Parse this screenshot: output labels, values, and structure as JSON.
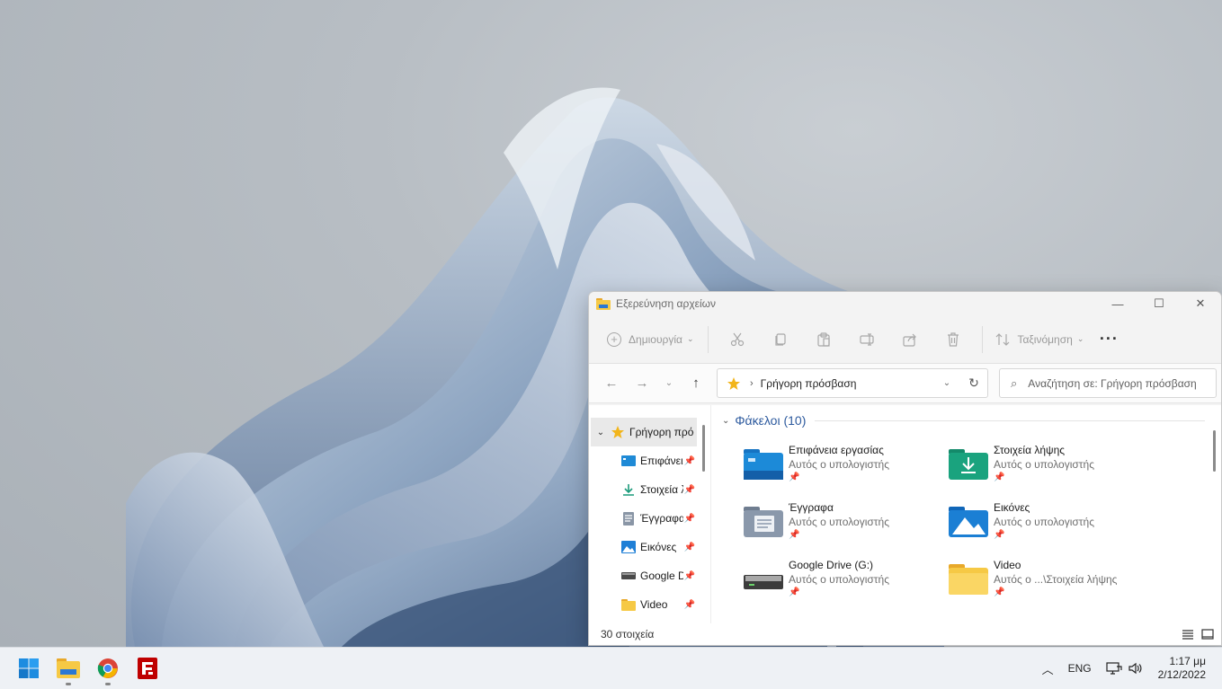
{
  "window": {
    "title": "Εξερεύνηση αρχείων",
    "controls": {
      "minimize": "—",
      "maximize": "☐",
      "close": "✕"
    }
  },
  "commandbar": {
    "new_label": "Δημιουργία",
    "sort_label": "Ταξινόμηση",
    "more_label": "···",
    "icons": [
      "cut-icon",
      "copy-icon",
      "paste-icon",
      "rename-icon",
      "share-icon",
      "delete-icon"
    ]
  },
  "address": {
    "crumb": "Γρήγορη πρόσβαση",
    "search_placeholder": "Αναζήτηση σε: Γρήγορη πρόσβαση"
  },
  "navpane": {
    "root_label": "Γρήγορη πρόσβαση",
    "items": [
      {
        "label": "Επιφάνεια εργασίας",
        "icon": "desktop-icon"
      },
      {
        "label": "Στοιχεία λήψης",
        "icon": "download-icon"
      },
      {
        "label": "Έγγραφα",
        "icon": "documents-icon"
      },
      {
        "label": "Εικόνες",
        "icon": "pictures-icon"
      },
      {
        "label": "Google Drive (G:)",
        "icon": "drive-icon"
      },
      {
        "label": "Video",
        "icon": "folder-icon"
      }
    ]
  },
  "main": {
    "group_header": "Φάκελοι (10)",
    "folders": [
      {
        "name": "Επιφάνεια εργασίας",
        "location": "Αυτός ο υπολογιστής",
        "icon": "desktop-folder-icon"
      },
      {
        "name": "Στοιχεία λήψης",
        "location": "Αυτός ο υπολογιστής",
        "icon": "downloads-folder-icon"
      },
      {
        "name": "Έγγραφα",
        "location": "Αυτός ο υπολογιστής",
        "icon": "documents-folder-icon"
      },
      {
        "name": "Εικόνες",
        "location": "Αυτός ο υπολογιστής",
        "icon": "pictures-folder-icon"
      },
      {
        "name": "Google Drive (G:)",
        "location": "Αυτός ο υπολογιστής",
        "icon": "drive-icon"
      },
      {
        "name": "Video",
        "location": "Αυτός ο ...\\Στοιχεία λήψης",
        "icon": "folder-icon"
      }
    ]
  },
  "statusbar": {
    "count": "30 στοιχεία"
  },
  "taskbar": {
    "apps": [
      "start-icon",
      "file-explorer-icon",
      "chrome-icon",
      "filezilla-icon"
    ],
    "language": "ENG",
    "time": "1:17 μμ",
    "date": "2/12/2022"
  },
  "colors": {
    "accent": "#2d5a9e",
    "folder_yellow": "#f6c945",
    "desktop_bg": "#b8bec4"
  }
}
